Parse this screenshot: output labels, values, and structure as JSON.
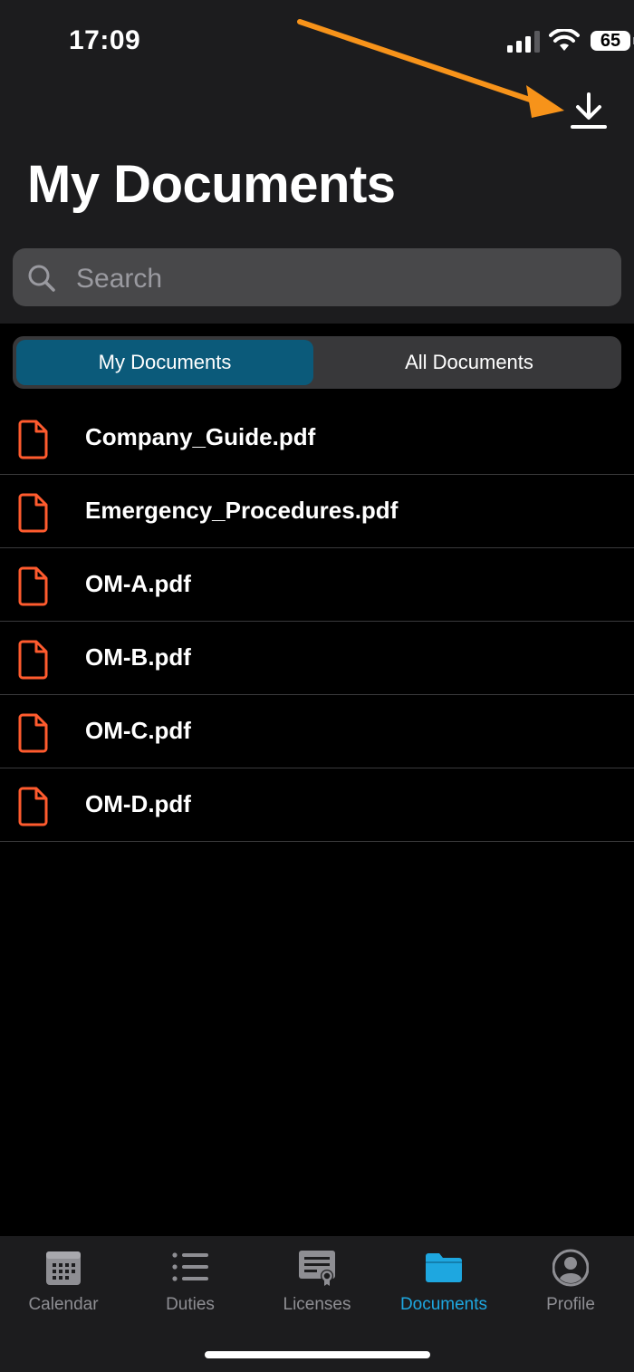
{
  "status_bar": {
    "time": "17:09",
    "battery": "65"
  },
  "header": {
    "title": "My Documents",
    "download_icon": "download-icon",
    "annotation_color": "#f7931a"
  },
  "search": {
    "placeholder": "Search",
    "icon": "search-icon"
  },
  "segmented_control": {
    "options": [
      "My Documents",
      "All Documents"
    ],
    "selected": "My Documents",
    "selected_color": "#0b5a7a"
  },
  "documents": [
    {
      "name": "Company_Guide.pdf"
    },
    {
      "name": "Emergency_Procedures.pdf"
    },
    {
      "name": "OM-A.pdf"
    },
    {
      "name": "OM-B.pdf"
    },
    {
      "name": "OM-C.pdf"
    },
    {
      "name": "OM-D.pdf"
    }
  ],
  "document_icon_color": "#ff5b2e",
  "tab_bar": {
    "items": [
      {
        "label": "Calendar",
        "icon": "calendar-icon"
      },
      {
        "label": "Duties",
        "icon": "list-icon"
      },
      {
        "label": "Licenses",
        "icon": "certificate-icon"
      },
      {
        "label": "Documents",
        "icon": "folder-icon"
      },
      {
        "label": "Profile",
        "icon": "person-icon"
      }
    ],
    "selected": "Documents",
    "active_color": "#1ea7e0"
  }
}
